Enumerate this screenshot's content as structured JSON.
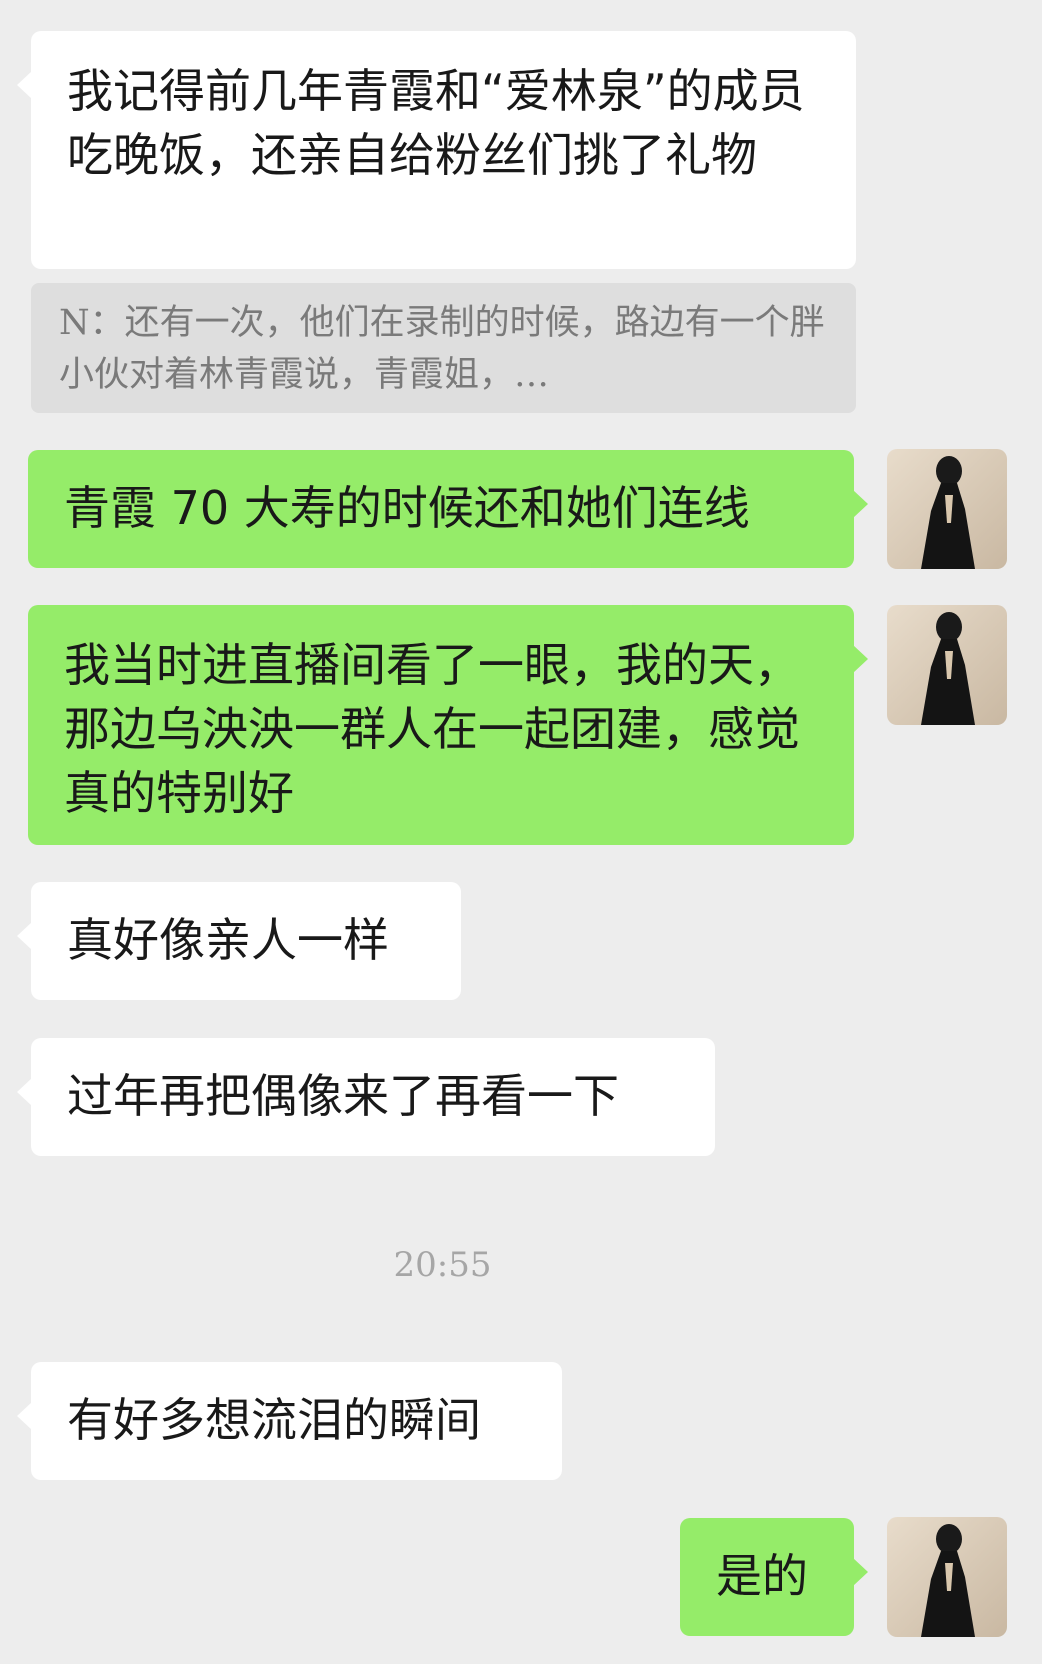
{
  "messages": [
    {
      "side": "incoming",
      "text": "我记得前几年青霞和“爱林泉”的成员吃晚饭，还亲自给粉丝们挑了礼物"
    },
    {
      "side": "quote",
      "text": "N：还有一次，他们在录制的时候，路边有一个胖小伙对着林青霞说，青霞姐，…"
    },
    {
      "side": "outgoing",
      "text": "青霞 70 大寿的时候还和她们连线"
    },
    {
      "side": "outgoing",
      "text": "我当时进直播间看了一眼，我的天，那边乌泱泱一群人在一起团建，感觉真的特别好"
    },
    {
      "side": "incoming",
      "text": "真好像亲人一样"
    },
    {
      "side": "incoming",
      "text": "过年再把偶像来了再看一下"
    },
    {
      "side": "incoming",
      "text": "有好多想流泪的瞬间"
    },
    {
      "side": "outgoing",
      "text": "是的"
    }
  ],
  "timestamp": "20:55",
  "colors": {
    "background": "#ededed",
    "incoming_bubble": "#ffffff",
    "outgoing_bubble": "#95ec69",
    "quote_bubble": "#dedede"
  },
  "avatar_icon": "user-avatar-photo"
}
